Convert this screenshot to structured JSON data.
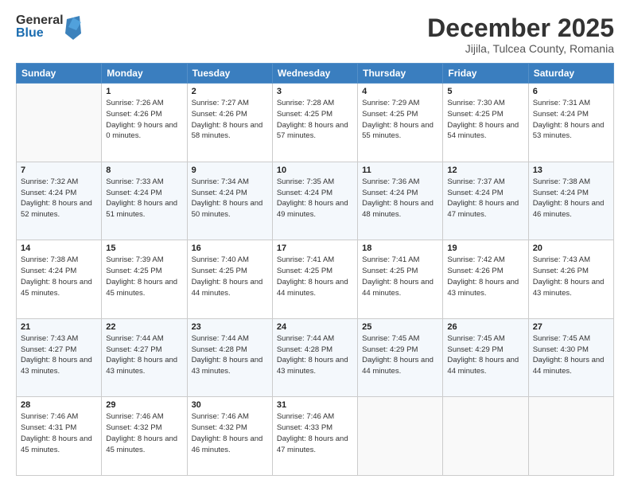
{
  "logo": {
    "general": "General",
    "blue": "Blue"
  },
  "header": {
    "month": "December 2025",
    "location": "Jijila, Tulcea County, Romania"
  },
  "weekdays": [
    "Sunday",
    "Monday",
    "Tuesday",
    "Wednesday",
    "Thursday",
    "Friday",
    "Saturday"
  ],
  "weeks": [
    [
      {
        "day": "",
        "sunrise": "",
        "sunset": "",
        "daylight": ""
      },
      {
        "day": "1",
        "sunrise": "Sunrise: 7:26 AM",
        "sunset": "Sunset: 4:26 PM",
        "daylight": "Daylight: 9 hours and 0 minutes."
      },
      {
        "day": "2",
        "sunrise": "Sunrise: 7:27 AM",
        "sunset": "Sunset: 4:26 PM",
        "daylight": "Daylight: 8 hours and 58 minutes."
      },
      {
        "day": "3",
        "sunrise": "Sunrise: 7:28 AM",
        "sunset": "Sunset: 4:25 PM",
        "daylight": "Daylight: 8 hours and 57 minutes."
      },
      {
        "day": "4",
        "sunrise": "Sunrise: 7:29 AM",
        "sunset": "Sunset: 4:25 PM",
        "daylight": "Daylight: 8 hours and 55 minutes."
      },
      {
        "day": "5",
        "sunrise": "Sunrise: 7:30 AM",
        "sunset": "Sunset: 4:25 PM",
        "daylight": "Daylight: 8 hours and 54 minutes."
      },
      {
        "day": "6",
        "sunrise": "Sunrise: 7:31 AM",
        "sunset": "Sunset: 4:24 PM",
        "daylight": "Daylight: 8 hours and 53 minutes."
      }
    ],
    [
      {
        "day": "7",
        "sunrise": "Sunrise: 7:32 AM",
        "sunset": "Sunset: 4:24 PM",
        "daylight": "Daylight: 8 hours and 52 minutes."
      },
      {
        "day": "8",
        "sunrise": "Sunrise: 7:33 AM",
        "sunset": "Sunset: 4:24 PM",
        "daylight": "Daylight: 8 hours and 51 minutes."
      },
      {
        "day": "9",
        "sunrise": "Sunrise: 7:34 AM",
        "sunset": "Sunset: 4:24 PM",
        "daylight": "Daylight: 8 hours and 50 minutes."
      },
      {
        "day": "10",
        "sunrise": "Sunrise: 7:35 AM",
        "sunset": "Sunset: 4:24 PM",
        "daylight": "Daylight: 8 hours and 49 minutes."
      },
      {
        "day": "11",
        "sunrise": "Sunrise: 7:36 AM",
        "sunset": "Sunset: 4:24 PM",
        "daylight": "Daylight: 8 hours and 48 minutes."
      },
      {
        "day": "12",
        "sunrise": "Sunrise: 7:37 AM",
        "sunset": "Sunset: 4:24 PM",
        "daylight": "Daylight: 8 hours and 47 minutes."
      },
      {
        "day": "13",
        "sunrise": "Sunrise: 7:38 AM",
        "sunset": "Sunset: 4:24 PM",
        "daylight": "Daylight: 8 hours and 46 minutes."
      }
    ],
    [
      {
        "day": "14",
        "sunrise": "Sunrise: 7:38 AM",
        "sunset": "Sunset: 4:24 PM",
        "daylight": "Daylight: 8 hours and 45 minutes."
      },
      {
        "day": "15",
        "sunrise": "Sunrise: 7:39 AM",
        "sunset": "Sunset: 4:25 PM",
        "daylight": "Daylight: 8 hours and 45 minutes."
      },
      {
        "day": "16",
        "sunrise": "Sunrise: 7:40 AM",
        "sunset": "Sunset: 4:25 PM",
        "daylight": "Daylight: 8 hours and 44 minutes."
      },
      {
        "day": "17",
        "sunrise": "Sunrise: 7:41 AM",
        "sunset": "Sunset: 4:25 PM",
        "daylight": "Daylight: 8 hours and 44 minutes."
      },
      {
        "day": "18",
        "sunrise": "Sunrise: 7:41 AM",
        "sunset": "Sunset: 4:25 PM",
        "daylight": "Daylight: 8 hours and 44 minutes."
      },
      {
        "day": "19",
        "sunrise": "Sunrise: 7:42 AM",
        "sunset": "Sunset: 4:26 PM",
        "daylight": "Daylight: 8 hours and 43 minutes."
      },
      {
        "day": "20",
        "sunrise": "Sunrise: 7:43 AM",
        "sunset": "Sunset: 4:26 PM",
        "daylight": "Daylight: 8 hours and 43 minutes."
      }
    ],
    [
      {
        "day": "21",
        "sunrise": "Sunrise: 7:43 AM",
        "sunset": "Sunset: 4:27 PM",
        "daylight": "Daylight: 8 hours and 43 minutes."
      },
      {
        "day": "22",
        "sunrise": "Sunrise: 7:44 AM",
        "sunset": "Sunset: 4:27 PM",
        "daylight": "Daylight: 8 hours and 43 minutes."
      },
      {
        "day": "23",
        "sunrise": "Sunrise: 7:44 AM",
        "sunset": "Sunset: 4:28 PM",
        "daylight": "Daylight: 8 hours and 43 minutes."
      },
      {
        "day": "24",
        "sunrise": "Sunrise: 7:44 AM",
        "sunset": "Sunset: 4:28 PM",
        "daylight": "Daylight: 8 hours and 43 minutes."
      },
      {
        "day": "25",
        "sunrise": "Sunrise: 7:45 AM",
        "sunset": "Sunset: 4:29 PM",
        "daylight": "Daylight: 8 hours and 44 minutes."
      },
      {
        "day": "26",
        "sunrise": "Sunrise: 7:45 AM",
        "sunset": "Sunset: 4:29 PM",
        "daylight": "Daylight: 8 hours and 44 minutes."
      },
      {
        "day": "27",
        "sunrise": "Sunrise: 7:45 AM",
        "sunset": "Sunset: 4:30 PM",
        "daylight": "Daylight: 8 hours and 44 minutes."
      }
    ],
    [
      {
        "day": "28",
        "sunrise": "Sunrise: 7:46 AM",
        "sunset": "Sunset: 4:31 PM",
        "daylight": "Daylight: 8 hours and 45 minutes."
      },
      {
        "day": "29",
        "sunrise": "Sunrise: 7:46 AM",
        "sunset": "Sunset: 4:32 PM",
        "daylight": "Daylight: 8 hours and 45 minutes."
      },
      {
        "day": "30",
        "sunrise": "Sunrise: 7:46 AM",
        "sunset": "Sunset: 4:32 PM",
        "daylight": "Daylight: 8 hours and 46 minutes."
      },
      {
        "day": "31",
        "sunrise": "Sunrise: 7:46 AM",
        "sunset": "Sunset: 4:33 PM",
        "daylight": "Daylight: 8 hours and 47 minutes."
      },
      {
        "day": "",
        "sunrise": "",
        "sunset": "",
        "daylight": ""
      },
      {
        "day": "",
        "sunrise": "",
        "sunset": "",
        "daylight": ""
      },
      {
        "day": "",
        "sunrise": "",
        "sunset": "",
        "daylight": ""
      }
    ]
  ]
}
